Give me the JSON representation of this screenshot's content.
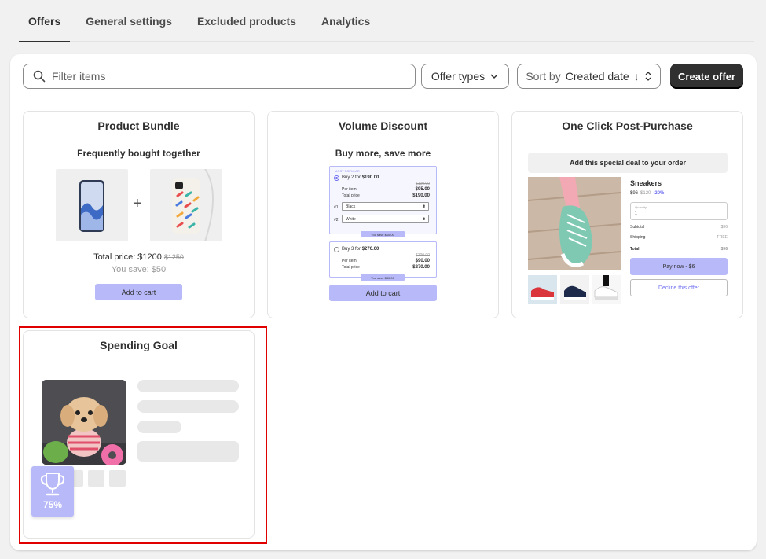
{
  "tabs": [
    {
      "label": "Offers",
      "active": true
    },
    {
      "label": "General settings",
      "active": false
    },
    {
      "label": "Excluded products",
      "active": false
    },
    {
      "label": "Analytics",
      "active": false
    }
  ],
  "toolbar": {
    "search_placeholder": "Filter items",
    "offer_types_label": "Offer types",
    "sort_prefix": "Sort by",
    "sort_value": "Created date",
    "sort_arrow": "↓",
    "create_label": "Create offer"
  },
  "cards": {
    "product_bundle": {
      "title": "Product Bundle",
      "subtitle": "Frequently bought together",
      "plus": "+",
      "total_label": "Total price: $1200",
      "total_old": "$1250",
      "save_label": "You save: $50",
      "button": "Add to cart"
    },
    "volume_discount": {
      "title": "Volume Discount",
      "subtitle": "Buy more, save more",
      "tag": "MOST POPULAR",
      "tier1": {
        "buy": "Buy 2 for",
        "buy_price": "$190.00",
        "old_per_item": "$100.00",
        "per_item_label": "Per item",
        "per_item": "$95.00",
        "total_label": "Total price",
        "total": "$190.00",
        "option1_label": "#1",
        "option1": "Black",
        "option2_label": "#2",
        "option2": "White",
        "badge": "You save $10.00"
      },
      "tier2": {
        "buy": "Buy 3 for",
        "buy_price": "$270.00",
        "old_per_item": "$100.00",
        "per_item_label": "Per item",
        "per_item": "$90.00",
        "total_label": "Total price",
        "total": "$270.00",
        "badge": "You save $30.00"
      },
      "button": "Add to cart"
    },
    "post_purchase": {
      "title": "One Click Post-Purchase",
      "banner": "Add this special deal to your order",
      "product": "Sneakers",
      "price": "$96",
      "old_price": "$120",
      "discount": "-20%",
      "qty_label": "Quantity",
      "qty_value": "1",
      "subtotal_label": "Subtotal",
      "subtotal": "$96",
      "shipping_label": "Shipping",
      "shipping": "FREE",
      "total_label": "Total",
      "total": "$96",
      "pay_button": "Pay now - $6",
      "decline_button": "Decline this offer"
    },
    "spending_goal": {
      "title": "Spending Goal",
      "progress_label": "75%",
      "progress": 0.75
    }
  },
  "colors": {
    "accent": "#b8b9f8",
    "accent_text": "#6d6ef0",
    "dark_button": "#303030",
    "highlight": "#e00000"
  }
}
